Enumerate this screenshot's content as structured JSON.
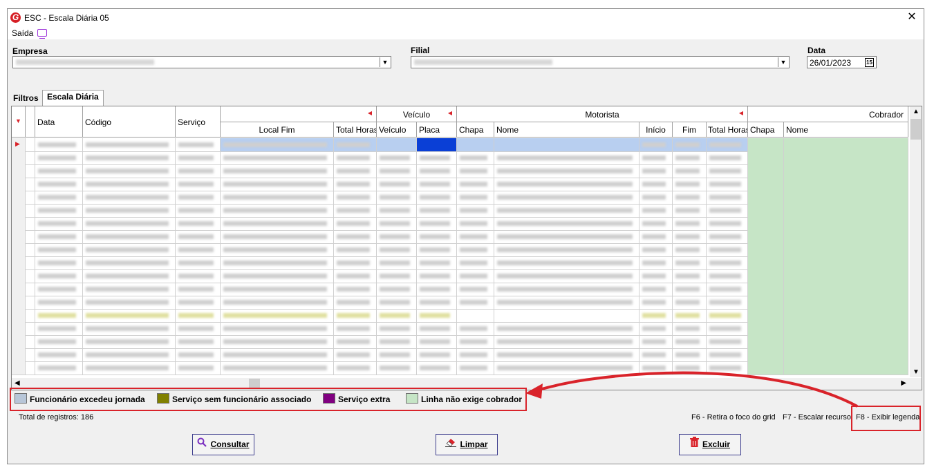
{
  "window": {
    "title": "ESC - Escala Diária 05",
    "close_symbol": "✕"
  },
  "menu": {
    "saida": "Saída"
  },
  "filters": {
    "empresa_label": "Empresa",
    "filial_label": "Filial",
    "data_label": "Data",
    "data_value": "26/01/2023",
    "calendar_glyph": "15"
  },
  "tabs": {
    "filtros": "Filtros",
    "escala": "Escala Diária"
  },
  "grid": {
    "group_headers": {
      "veiculo": "Veículo",
      "motorista": "Motorista",
      "cobrador": "Cobrador"
    },
    "columns": {
      "data": "Data",
      "codigo": "Código",
      "servico": "Serviço",
      "local_fim": "Local Fim",
      "total_horas": "Total Horas",
      "veiculo": "Veículo",
      "placa": "Placa",
      "chapa": "Chapa",
      "nome": "Nome",
      "inicio": "Início",
      "fim": "Fim",
      "total_horas_motorista": "Total Horas",
      "cobrador_chapa": "Chapa",
      "cobrador_nome": "Nome"
    }
  },
  "legend": {
    "items": [
      {
        "label": "Funcionário excedeu jornada",
        "color": "#b8c6d8"
      },
      {
        "label": "Serviço sem funcionário associado",
        "color": "#808000"
      },
      {
        "label": "Serviço extra",
        "color": "#800080"
      },
      {
        "label": "Linha não exige cobrador",
        "color": "#c6e5c6"
      }
    ]
  },
  "status": {
    "total": "Total de registros: 186",
    "f6": "F6 - Retira o foco do grid",
    "f7": "F7 - Escalar recurso",
    "f8": "F8 - Exibir legenda"
  },
  "buttons": {
    "consultar": "Consultar",
    "limpar": "Limpar",
    "excluir": "Excluir"
  },
  "colors": {
    "annotation": "#d9232a",
    "no_cobrador": "#c6e5c6",
    "selected": "#b8cff0"
  }
}
